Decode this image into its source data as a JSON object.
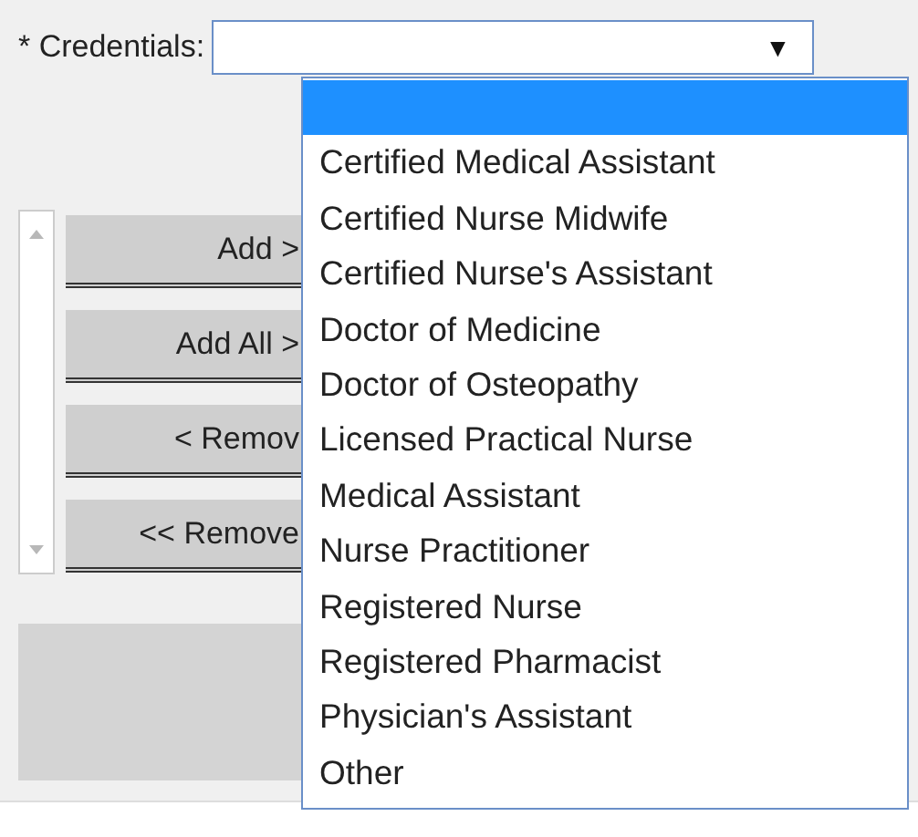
{
  "credentials": {
    "label": "* Credentials:",
    "arrow": "▼",
    "options": [
      {
        "selected": true
      },
      {
        "label": "Certified Medical Assistant",
        "selected": false
      },
      {
        "label": "Certified Nurse Midwife",
        "selected": false
      },
      {
        "label": "Certified Nurse's Assistant",
        "selected": false
      },
      {
        "label": "Doctor of Medicine",
        "selected": false
      },
      {
        "label": "Doctor of Osteopathy",
        "selected": false
      },
      {
        "label": "Licensed Practical Nurse",
        "selected": false
      },
      {
        "label": "Medical Assistant",
        "selected": false
      },
      {
        "label": "Nurse Practitioner",
        "selected": false
      },
      {
        "label": "Registered Nurse",
        "selected": false
      },
      {
        "label": "Registered Pharmacist",
        "selected": false
      },
      {
        "label": "Physician's Assistant",
        "selected": false
      },
      {
        "label": "Other",
        "selected": false
      }
    ]
  },
  "buttons": [
    "Add >",
    "Add All >",
    "< Remov",
    "<< Remove"
  ]
}
